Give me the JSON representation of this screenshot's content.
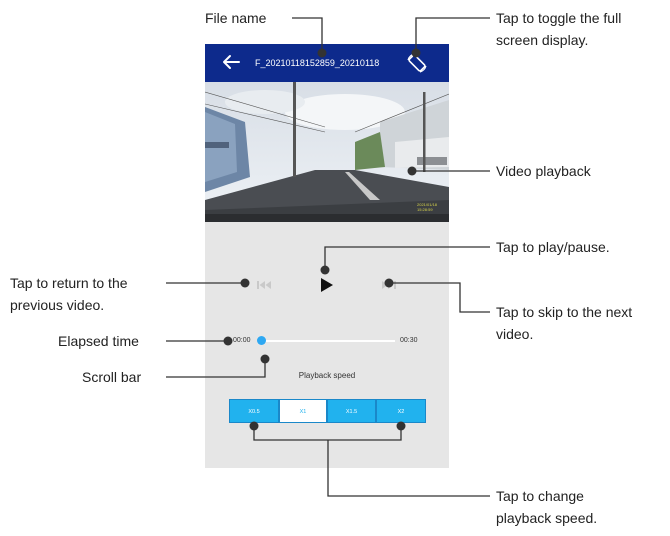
{
  "app_bar": {
    "back_icon": "left-arrow-icon",
    "file_name": "F_20210118152859_20210118",
    "rotate_icon": "screen-rotate-icon",
    "background": "#0d2a8c"
  },
  "video": {
    "description_icon": "dashcam-video-frame"
  },
  "controls": {
    "prev_icon": "skip-previous-icon",
    "play_icon": "play-icon",
    "next_icon": "skip-next-icon"
  },
  "progress": {
    "elapsed": "00:00",
    "total": "00:30",
    "value": 0
  },
  "speed": {
    "label": "Playback speed",
    "options": [
      "X0.5",
      "X1",
      "X1.5",
      "X2"
    ],
    "selected": "X1",
    "accent": "#21b2ee"
  },
  "callouts": {
    "file_name": "File name",
    "toggle_full_line1": "Tap to toggle the full",
    "toggle_full_line2": "screen display.",
    "video_playback": "Video playback",
    "play_pause": "Tap to play/pause.",
    "return_line1": "Tap to return to the",
    "return_line2": "previous video.",
    "skip_line1": "Tap to skip to the next",
    "skip_line2": "video.",
    "elapsed_time": "Elapsed time",
    "scroll_bar": "Scroll bar",
    "change_speed_line1": "Tap to change",
    "change_speed_line2": "playback speed."
  }
}
